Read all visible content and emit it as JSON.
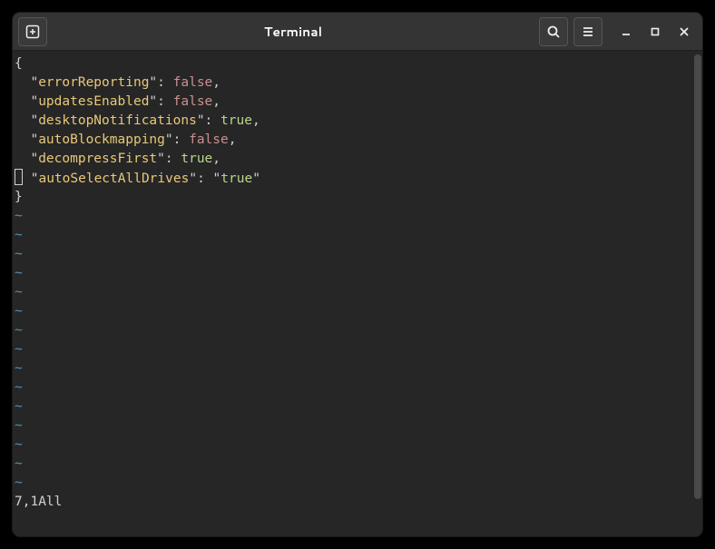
{
  "window": {
    "title": "Terminal"
  },
  "editor": {
    "lines": [
      {
        "type": "brace",
        "text": "{"
      },
      {
        "type": "kv",
        "indent": "  ",
        "key": "errorReporting",
        "sep": ": ",
        "value": "false",
        "valueType": "false",
        "trail": ","
      },
      {
        "type": "kv",
        "indent": "  ",
        "key": "updatesEnabled",
        "sep": ": ",
        "value": "false",
        "valueType": "false",
        "trail": ","
      },
      {
        "type": "kv",
        "indent": "  ",
        "key": "desktopNotifications",
        "sep": ": ",
        "value": "true",
        "valueType": "true",
        "trail": ","
      },
      {
        "type": "kv",
        "indent": "  ",
        "key": "autoBlockmapping",
        "sep": ": ",
        "value": "false",
        "valueType": "false",
        "trail": ","
      },
      {
        "type": "kv",
        "indent": "  ",
        "key": "decompressFirst",
        "sep": ": ",
        "value": "true",
        "valueType": "true",
        "trail": ","
      },
      {
        "type": "kv_cursor",
        "indent": " ",
        "key": "autoSelectAllDrives",
        "sep": ": ",
        "prequote": "\"",
        "value": "true",
        "valueType": "true",
        "postquote": "\"",
        "trail": ""
      },
      {
        "type": "brace",
        "text": "}"
      }
    ],
    "tilde_count": 15,
    "tilde_char": "~",
    "status": {
      "position": "7,1",
      "scroll": "All"
    }
  }
}
